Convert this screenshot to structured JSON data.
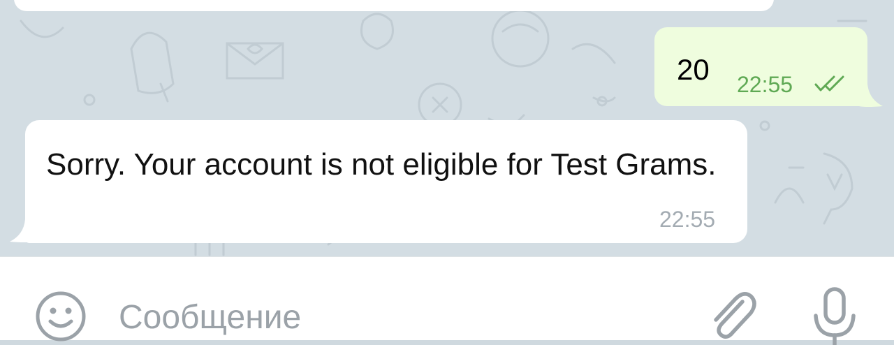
{
  "messages": {
    "outgoing": {
      "text": "20",
      "time": "22:55",
      "status_icon": "double-check-icon"
    },
    "incoming": {
      "text": "Sorry. Your account is not eligible for Test Grams.",
      "time": "22:55"
    }
  },
  "composer": {
    "placeholder": "Сообщение",
    "icons": {
      "emoji": "smiley-icon",
      "attach": "paperclip-icon",
      "voice": "microphone-icon"
    }
  },
  "colors": {
    "chat_background": "#d3dde3",
    "outgoing_bubble": "#effdde",
    "incoming_bubble": "#ffffff",
    "outgoing_time": "#5fa954",
    "incoming_time": "#a3abb2",
    "icon_gray": "#9ba2a8"
  }
}
